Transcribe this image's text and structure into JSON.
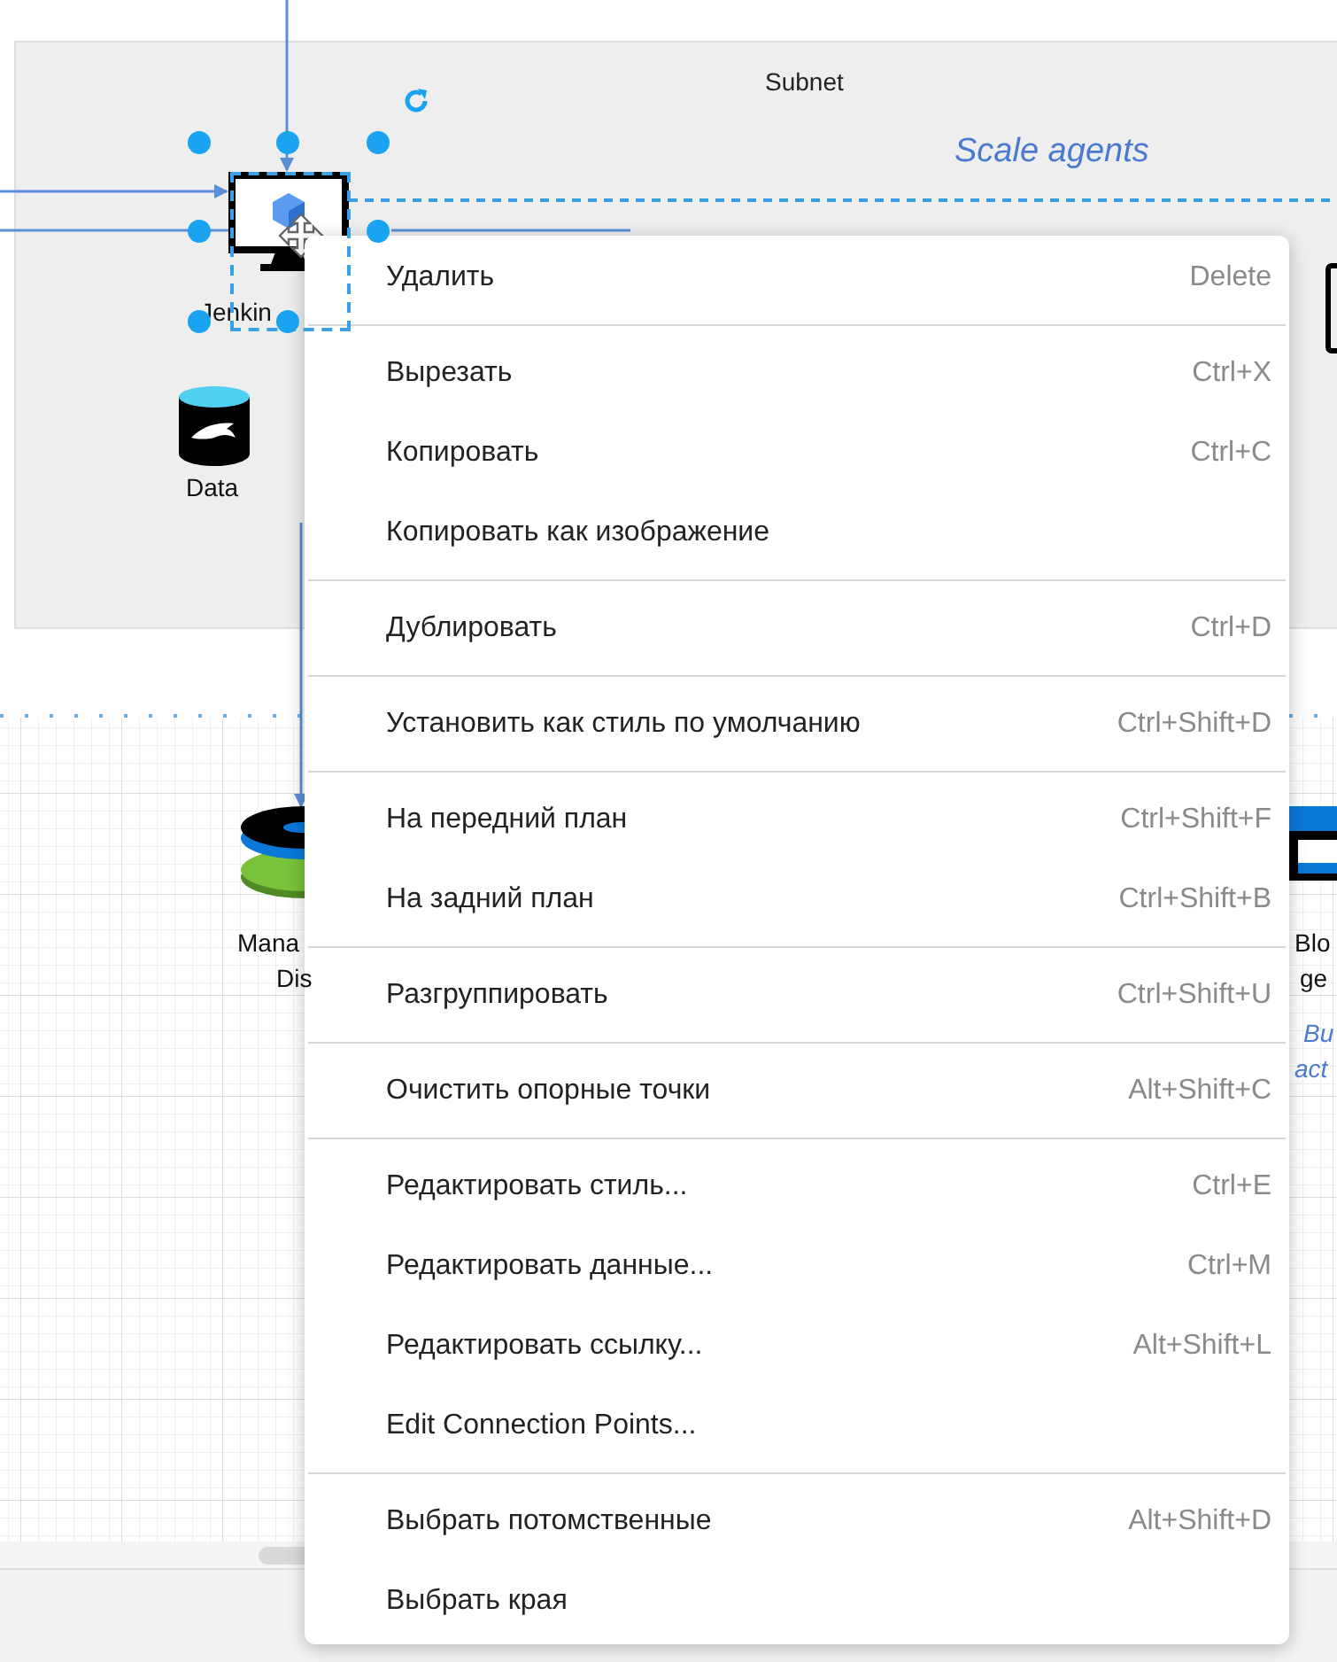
{
  "canvas": {
    "subnet": {
      "title": "Subnet",
      "note": "Scale agents"
    },
    "shapes": [
      {
        "kind": "vm",
        "label": "Jenkin",
        "selected": true
      },
      {
        "kind": "database",
        "label": "Data"
      },
      {
        "kind": "disks",
        "label_lines": [
          "Mana",
          "Dis"
        ]
      },
      {
        "kind": "blob",
        "label_lines": [
          "Blo",
          "ge"
        ],
        "note_lines": [
          "Bu",
          "act"
        ]
      }
    ]
  },
  "context_menu": {
    "groups": [
      {
        "items": [
          {
            "label": "Удалить",
            "shortcut": "Delete"
          }
        ]
      },
      {
        "items": [
          {
            "label": "Вырезать",
            "shortcut": "Ctrl+X"
          },
          {
            "label": "Копировать",
            "shortcut": "Ctrl+C"
          },
          {
            "label": "Копировать как изображение"
          }
        ]
      },
      {
        "items": [
          {
            "label": "Дублировать",
            "shortcut": "Ctrl+D"
          }
        ]
      },
      {
        "items": [
          {
            "label": "Установить как стиль по умолчанию",
            "shortcut": "Ctrl+Shift+D"
          }
        ]
      },
      {
        "items": [
          {
            "label": "На передний план",
            "shortcut": "Ctrl+Shift+F"
          },
          {
            "label": "На задний план",
            "shortcut": "Ctrl+Shift+B"
          }
        ]
      },
      {
        "items": [
          {
            "label": "Разгруппировать",
            "shortcut": "Ctrl+Shift+U"
          }
        ]
      },
      {
        "items": [
          {
            "label": "Очистить опорные точки",
            "shortcut": "Alt+Shift+C"
          }
        ]
      },
      {
        "items": [
          {
            "label": "Редактировать стиль...",
            "shortcut": "Ctrl+E"
          },
          {
            "label": "Редактировать данные...",
            "shortcut": "Ctrl+M"
          },
          {
            "label": "Редактировать ссылку...",
            "shortcut": "Alt+Shift+L"
          },
          {
            "label": "Edit Connection Points..."
          }
        ]
      },
      {
        "items": [
          {
            "label": "Выбрать потомственные",
            "shortcut": "Alt+Shift+D"
          },
          {
            "label": "Выбрать края"
          }
        ]
      }
    ]
  }
}
